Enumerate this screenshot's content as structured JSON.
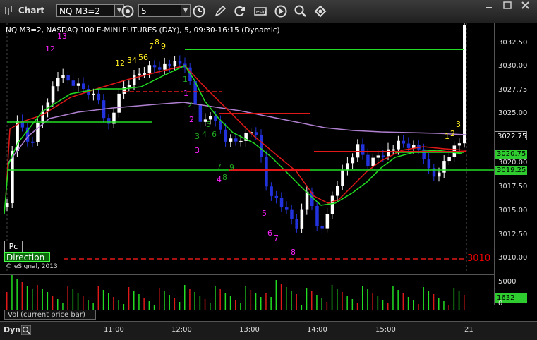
{
  "toolbar": {
    "title": "Chart",
    "symbol": "NQ M3=2",
    "interval": "5",
    "icons": [
      "chart-icon",
      "clock-icon",
      "pencil-icon",
      "refresh-icon",
      "esig-icon",
      "play-icon",
      "zoom-icon",
      "settings-icon"
    ]
  },
  "chart": {
    "header": "NQ M3=2, NASDAQ 100 E-MINI FUTURES (DAY), 5, 09:30-16:15 (Dynamic)",
    "copyright": "© eSignal, 2013",
    "pc_label": "Pc",
    "direction_label": "Direction",
    "ref_level": "3010",
    "price_ticks": [
      "3032.50",
      "3030.00",
      "3027.75",
      "3025.00",
      "3022.75",
      "3020.00",
      "3017.50",
      "3015.00",
      "3012.50",
      "3010.00"
    ],
    "price_tags": [
      {
        "value": "3022.75",
        "color": "#ffffff",
        "bg": "#000000"
      },
      {
        "value": "3020.75",
        "color": "#000000",
        "bg": "#2ecc2e"
      },
      {
        "value": "3019.25",
        "color": "#000000",
        "bg": "#2ecc2e"
      }
    ],
    "time_ticks": [
      "11:00",
      "12:00",
      "13:00",
      "14:00",
      "15:00",
      "21"
    ],
    "dyn_label": "Dyn",
    "annotations_magenta": [
      "13",
      "12",
      "1",
      "2",
      "3",
      "4",
      "5",
      "6",
      "7",
      "8"
    ],
    "annotations_yellow": [
      "12",
      "34",
      "56",
      "7",
      "8",
      "9",
      "1",
      "2",
      "3"
    ],
    "annotations_green": [
      "1",
      "2",
      "3",
      "4",
      "5",
      "6",
      "7",
      "8",
      "9"
    ]
  },
  "volume": {
    "label": "Vol (current price bar)",
    "ticks": [
      "5000",
      "1632",
      "0"
    ]
  },
  "colors": {
    "up_bar": "#ffffff",
    "down_bar": "#2233dd",
    "red_ma": "#e01818",
    "green_ma": "#22dd22",
    "purple_ma": "#b080d0",
    "magenta_text": "#ff22ff",
    "yellow_text": "#ffee22"
  }
}
